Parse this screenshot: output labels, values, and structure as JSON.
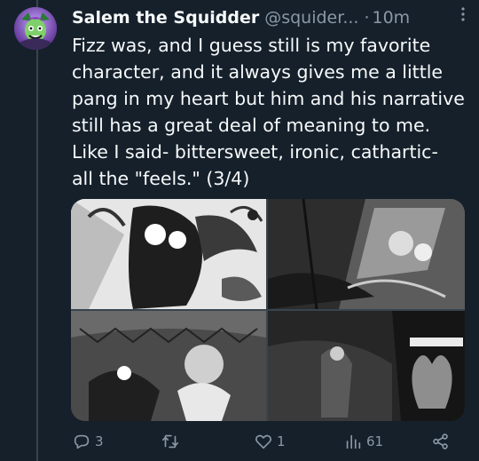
{
  "tweet": {
    "display_name": "Salem the Squidder",
    "handle": "@squider...",
    "separator": "·",
    "time": "10m",
    "text": "Fizz was, and I guess still is my favorite\ncharacter, and it always gives me a little\npang in my heart but him and his narrative\nstill has a great deal of meaning to me.\nLike I said- bittersweet, ironic, cathartic-\nall the \"feels.\" (3/4)"
  },
  "actions": {
    "reply_count": "3",
    "retweet_count": "",
    "like_count": "1",
    "view_count": "61"
  },
  "icons": {
    "more": "more-dots-icon",
    "reply": "reply-icon",
    "retweet": "retweet-icon",
    "like": "heart-icon",
    "views": "views-chart-icon",
    "share": "share-icon"
  },
  "colors": {
    "background": "#15202b",
    "text": "#f7f9f9",
    "muted": "#8b98a5",
    "divider": "#38444d"
  }
}
